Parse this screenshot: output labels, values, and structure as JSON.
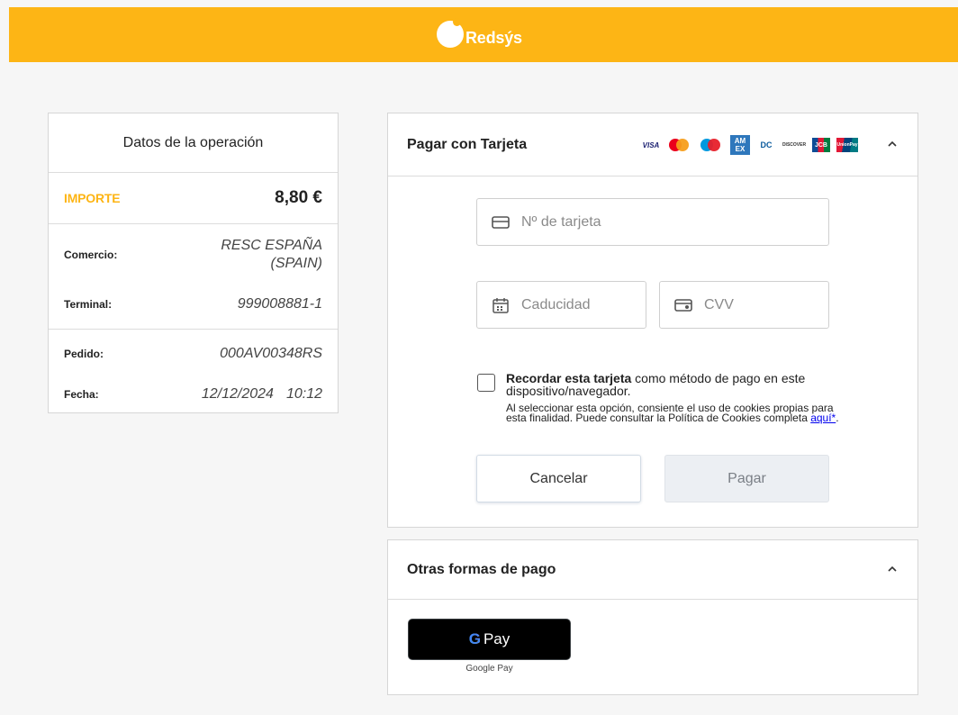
{
  "header": {
    "logo_text": "Redsýs"
  },
  "summary": {
    "title": "Datos de la operación",
    "amount_label": "IMPORTE",
    "amount_value": "8,80 €",
    "comercio_label": "Comercio:",
    "comercio_value_line1": "RESC ESPAÑA",
    "comercio_value_line2": "(SPAIN)",
    "terminal_label": "Terminal:",
    "terminal_value": "999008881-1",
    "pedido_label": "Pedido:",
    "pedido_value": "000AV00348RS",
    "fecha_label": "Fecha:",
    "fecha_date": "12/12/2024",
    "fecha_time": "10:12"
  },
  "card_panel": {
    "title": "Pagar con Tarjeta",
    "brands": [
      "visa",
      "mastercard",
      "maestro",
      "amex",
      "diners",
      "discover",
      "jcb",
      "unionpay"
    ],
    "brand_visa": "VISA",
    "brand_amex": "AM EX",
    "brand_diners": "DC",
    "brand_discover": "DISCOVER",
    "brand_jcb": "JCB",
    "brand_union": "UnionPay",
    "card_number_placeholder": "Nº de tarjeta",
    "expiry_placeholder": "Caducidad",
    "cvv_placeholder": "CVV",
    "remember_bold": "Recordar esta tarjeta",
    "remember_rest": " como método de pago en este dispositivo/navegador.",
    "cookies_text": "Al seleccionar esta opción, consiente el uso de cookies propias para esta finalidad. Puede consultar la Política de Cookies completa ",
    "cookies_link": "aquí*",
    "cookies_end": ".",
    "cancel_label": "Cancelar",
    "pay_label": "Pagar"
  },
  "other_panel": {
    "title": "Otras formas de pago",
    "gpay_g": "G",
    "gpay_label": "Pay",
    "gpay_caption": "Google Pay"
  },
  "colors": {
    "brand_yellow": "#fdb515",
    "background": "#f6f6f6",
    "link": "#0000ee"
  },
  "icons": {
    "card_number": "credit-card-icon",
    "expiry": "calendar-icon",
    "cvv": "card-cvv-icon",
    "collapse": "chevron-up-icon"
  }
}
